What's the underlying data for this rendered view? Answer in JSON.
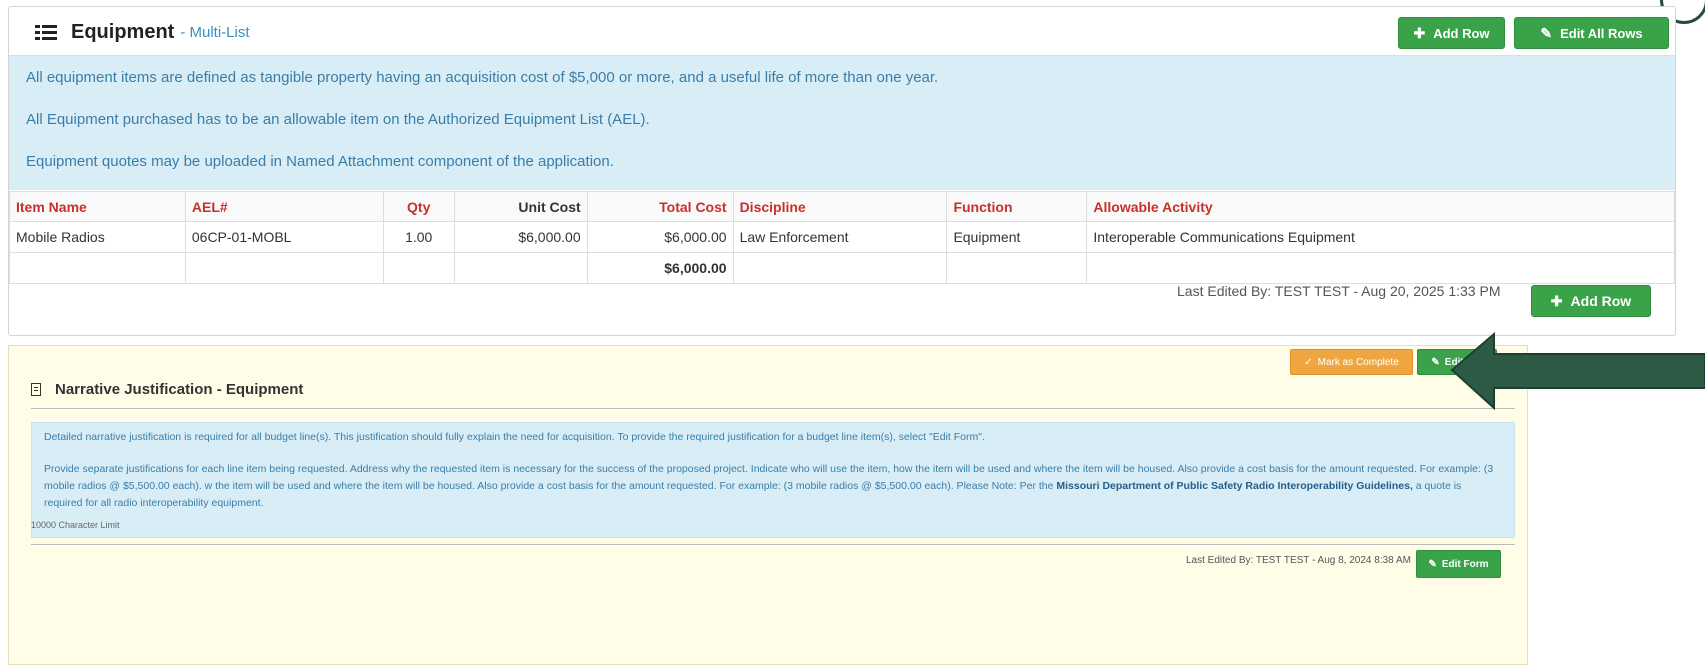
{
  "equipment": {
    "title": "Equipment",
    "subtitle": "- Multi-List",
    "add_row_label": "Add Row",
    "edit_all_label": "Edit All Rows",
    "info_lines": [
      "All equipment items are defined as tangible property having an acquisition cost of $5,000 or more, and a useful life of more than one year.",
      "All Equipment purchased has to be an allowable item on the Authorized Equipment List (AEL).",
      "Equipment quotes may be uploaded in Named Attachment component of the application."
    ],
    "columns": [
      "Item Name",
      "AEL#",
      "Qty",
      "Unit Cost",
      "Total Cost",
      "Discipline",
      "Function",
      "Allowable Activity"
    ],
    "rows": [
      [
        "Mobile Radios",
        "06CP-01-MOBL",
        "1.00",
        "$6,000.00",
        "$6,000.00",
        "Law Enforcement",
        "Equipment",
        "Interoperable Communications Equipment"
      ]
    ],
    "total": "$6,000.00",
    "last_edited": "Last Edited By: TEST TEST - Aug 20, 2025 1:33 PM",
    "add_row_bottom_label": "Add Row"
  },
  "narrative": {
    "title": "Narrative Justification - Equipment",
    "mark_complete_label": "Mark as Complete",
    "edit_form_label": "Edit Form",
    "edit_form_top_label": "Edit For",
    "para1": "Detailed narrative justification is required for all budget line(s). This justification should fully explain the need for acquisition. To provide the required justification for a budget line item(s), select \"Edit Form\".",
    "para2_a": "Provide separate justifications for each line item being requested. Address why the requested item is necessary for the success of the proposed project. Indicate who will use the item, how the item will be used and where the item will be housed. Also provide a cost basis for the amount requested. For example: (3 mobile radios @ $5,500.00 each). w the item will be used and where the item will be housed. Also provide a cost basis for the amount requested. For example: (3 mobile radios @ $5,500.00 each). Please Note: Per the ",
    "para2_link": "Missouri Department of Public Safety Radio Interoperability Guidelines,",
    "para2_b": " a quote is required for all radio interoperability equipment.",
    "char_limit": "10000 Character Limit",
    "last_edited": "Last Edited By: TEST TEST - Aug 8, 2024 8:38 AM"
  },
  "colors": {
    "green": "#3aa34a",
    "orange": "#f0a640",
    "info_bg": "#d9edf7",
    "header_red": "#c9302c",
    "arrow": "#2c5a45"
  }
}
